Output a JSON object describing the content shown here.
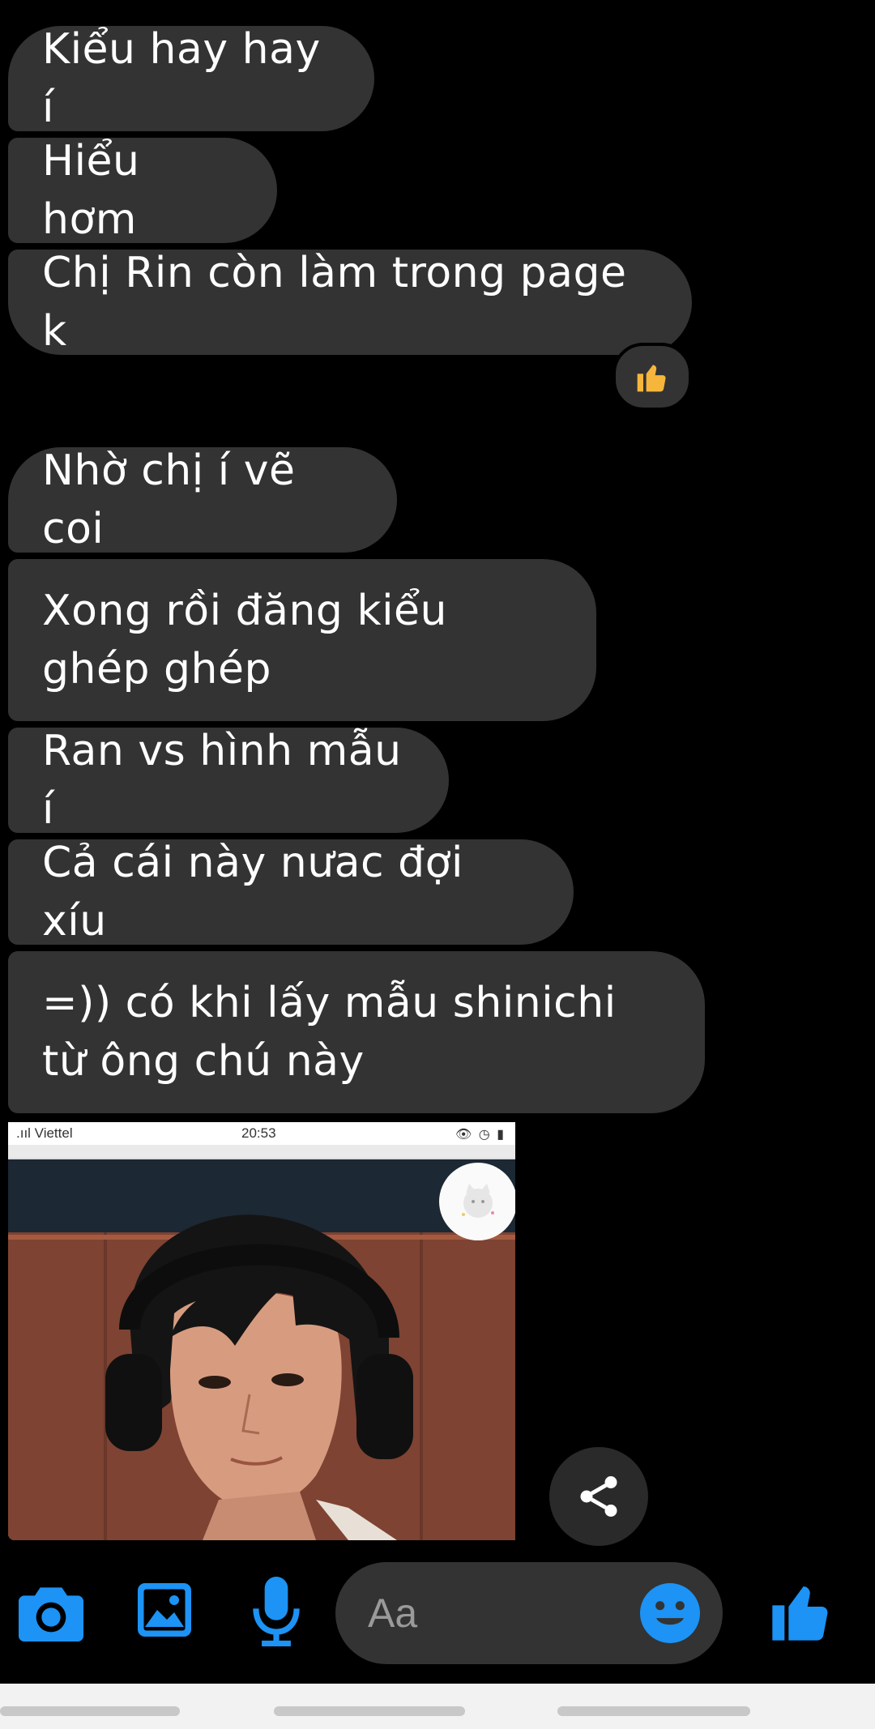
{
  "messages": [
    {
      "text": "Kiểu hay hay í"
    },
    {
      "text": "Hiểu hơm"
    },
    {
      "text": "Chị Rin còn làm trong page k",
      "reaction": "thumbs-up"
    },
    {
      "text": "Nhờ chị í vẽ coi"
    },
    {
      "text": "Xong rồi đăng kiểu ghép ghép"
    },
    {
      "text": "Ran vs hình mẫu í"
    },
    {
      "text": "Cả cái này nưac đợi xíu"
    },
    {
      "text": "=)) có khi lấy mẫu shinichi từ ông chú này"
    }
  ],
  "shared_image": {
    "status_bar": {
      "carrier": ".ııl Viettel",
      "time": "20:53"
    }
  },
  "composer": {
    "placeholder": "Aa"
  },
  "colors": {
    "bubble": "#333333",
    "accent": "#1c93f5",
    "background": "#000000"
  }
}
